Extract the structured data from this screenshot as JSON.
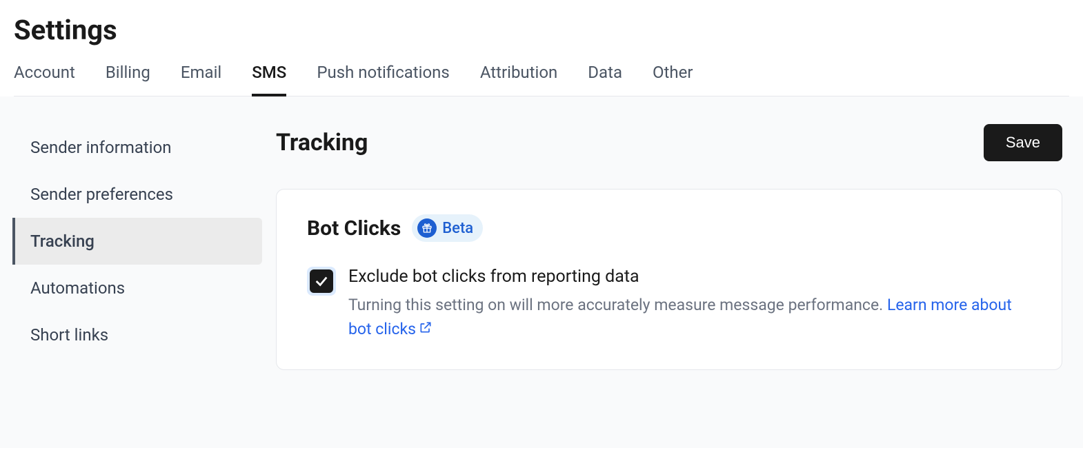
{
  "header": {
    "title": "Settings"
  },
  "tabs": [
    {
      "label": "Account",
      "active": false
    },
    {
      "label": "Billing",
      "active": false
    },
    {
      "label": "Email",
      "active": false
    },
    {
      "label": "SMS",
      "active": true
    },
    {
      "label": "Push notifications",
      "active": false
    },
    {
      "label": "Attribution",
      "active": false
    },
    {
      "label": "Data",
      "active": false
    },
    {
      "label": "Other",
      "active": false
    }
  ],
  "sidebar": {
    "items": [
      {
        "label": "Sender information",
        "active": false
      },
      {
        "label": "Sender preferences",
        "active": false
      },
      {
        "label": "Tracking",
        "active": true
      },
      {
        "label": "Automations",
        "active": false
      },
      {
        "label": "Short links",
        "active": false
      }
    ]
  },
  "main": {
    "section_title": "Tracking",
    "save_label": "Save",
    "card": {
      "title": "Bot Clicks",
      "badge_label": "Beta",
      "checkbox": {
        "checked": true,
        "label": "Exclude bot clicks from reporting data",
        "description": "Turning this setting on will more accurately measure message performance. ",
        "link_text": "Learn more about bot clicks"
      }
    }
  }
}
